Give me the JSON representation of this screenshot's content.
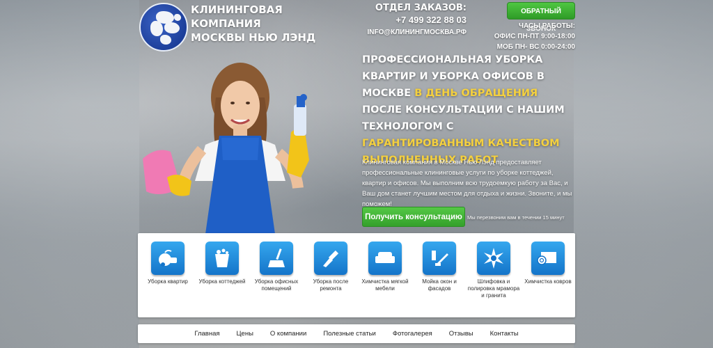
{
  "company": {
    "name_line1": "КЛИНИНГОВАЯ КОМПАНИЯ",
    "name_line2": "МОСКВЫ НЬЮ ЛЭНД"
  },
  "orders": {
    "label": "ОТДЕЛ ЗАКАЗОВ:",
    "phone": "+7 499 322 88 03",
    "email": "INFO@КЛИНИНГМОСКВА.РФ"
  },
  "callback_button": "ОБРАТНЫЙ ЗВОНОК",
  "hours": {
    "title": "ЧАСЫ РАБОТЫ:",
    "office": "ОФИС ПН-ПТ 9:00-18:00",
    "mobile": "МОБ ПН- ВС 0:00-24:00"
  },
  "headline": {
    "part1": "ПРОФЕССИОНАЛЬНАЯ УБОРКА КВАРТИР И УБОРКА ОФИСОВ В МОСКВЕ ",
    "highlight1": "В ДЕНЬ ОБРАЩЕНИЯ",
    "part2": "ПОСЛЕ КОНСУЛЬТАЦИИ С НАШИМ ТЕХНОЛОГОМ С ",
    "highlight2": "ГАРАНТИРОВАННЫМ КАЧЕСТВОМ ВЫПОЛНЕННЫХ РАБОТ"
  },
  "description": "Клининговая компания в Москве Нью Лэнд предоставляет профессиональные клининговые услуги по уборке коттеджей, квартир и офисов. Мы выполним всю трудоемкую работу за Вас, и Ваш дом станет лучшим местом для отдыха и жизни. Звоните, и мы поможем!",
  "consult_button": "Получить консультацию",
  "callback_note": "Мы перезвоним вам в течении 15 минут",
  "services": [
    {
      "label": "Уборка квартир",
      "icon": "vacuum-cleaner-icon"
    },
    {
      "label": "Уборка коттеджей",
      "icon": "bucket-icon"
    },
    {
      "label": "Уборка офисных помещений",
      "icon": "broom-icon"
    },
    {
      "label": "Уборка после ремонта",
      "icon": "paint-brush-icon"
    },
    {
      "label": "Химчистка мягкой мебели",
      "icon": "sofa-icon"
    },
    {
      "label": "Мойка окон и фасадов",
      "icon": "window-squeegee-icon"
    },
    {
      "label": "Шлифовка и полировка мрамора и гранита",
      "icon": "star-burst-icon"
    },
    {
      "label": "Химчистка ковров",
      "icon": "carpet-roll-icon"
    }
  ],
  "nav": [
    "Главная",
    "Цены",
    "О компании",
    "Полезные статьи",
    "Фотогалерея",
    "Отзывы",
    "Контакты"
  ],
  "colors": {
    "accent_green": "#3aa82f",
    "highlight_yellow": "#f4d03f",
    "tile_blue": "#1f8ddf"
  }
}
